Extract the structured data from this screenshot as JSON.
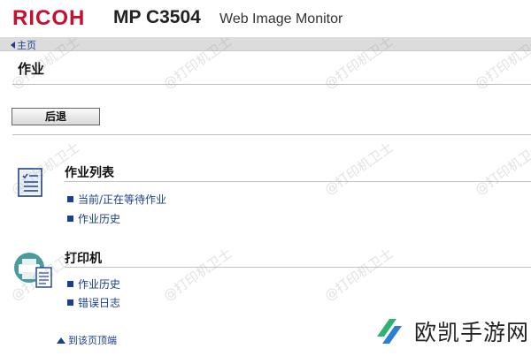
{
  "header": {
    "brand": "RICOH",
    "model": "MP C3504",
    "subtitle": "Web Image Monitor"
  },
  "nav": {
    "home_label": "主页"
  },
  "page": {
    "title": "作业",
    "back_label": "后退"
  },
  "sections": [
    {
      "title": "作业列表",
      "icon": "job-list-icon",
      "links": [
        "当前/正在等待作业",
        "作业历史"
      ]
    },
    {
      "title": "打印机",
      "icon": "printer-icon",
      "links": [
        "作业历史",
        "错误日志"
      ]
    }
  ],
  "footer": {
    "top_link": "到该页顶端"
  },
  "watermark": {
    "text": "@打印机卫士"
  },
  "site_logo": {
    "text": "欧凯手游网"
  },
  "colors": {
    "brand": "#c8102e",
    "link": "#1a3f8f",
    "navbar": "#dcdcdc"
  }
}
